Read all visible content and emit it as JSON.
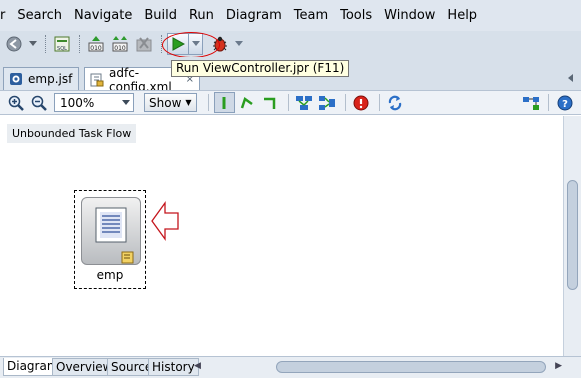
{
  "menubar": {
    "items": [
      "r",
      "Search",
      "Navigate",
      "Build",
      "Run",
      "Diagram",
      "Team",
      "Tools",
      "Window",
      "Help"
    ]
  },
  "toolbar": {
    "tooltip": "Run ViewController.jpr (F11)"
  },
  "tabs": {
    "items": [
      {
        "label": "emp.jsf"
      },
      {
        "label": "adfc-config.xml"
      }
    ]
  },
  "diagram_toolbar": {
    "zoom_value": "100%",
    "show_label": "Show"
  },
  "canvas": {
    "flow_label": "Unbounded Task Flow",
    "activity_label": "emp"
  },
  "bottom_tabs": {
    "items": [
      "Diagram",
      "Overview",
      "Source",
      "History"
    ]
  },
  "colors": {
    "run_green": "#2a9d20",
    "annotation_red": "#d00000",
    "menubar_bg": "#dfe6ef"
  }
}
